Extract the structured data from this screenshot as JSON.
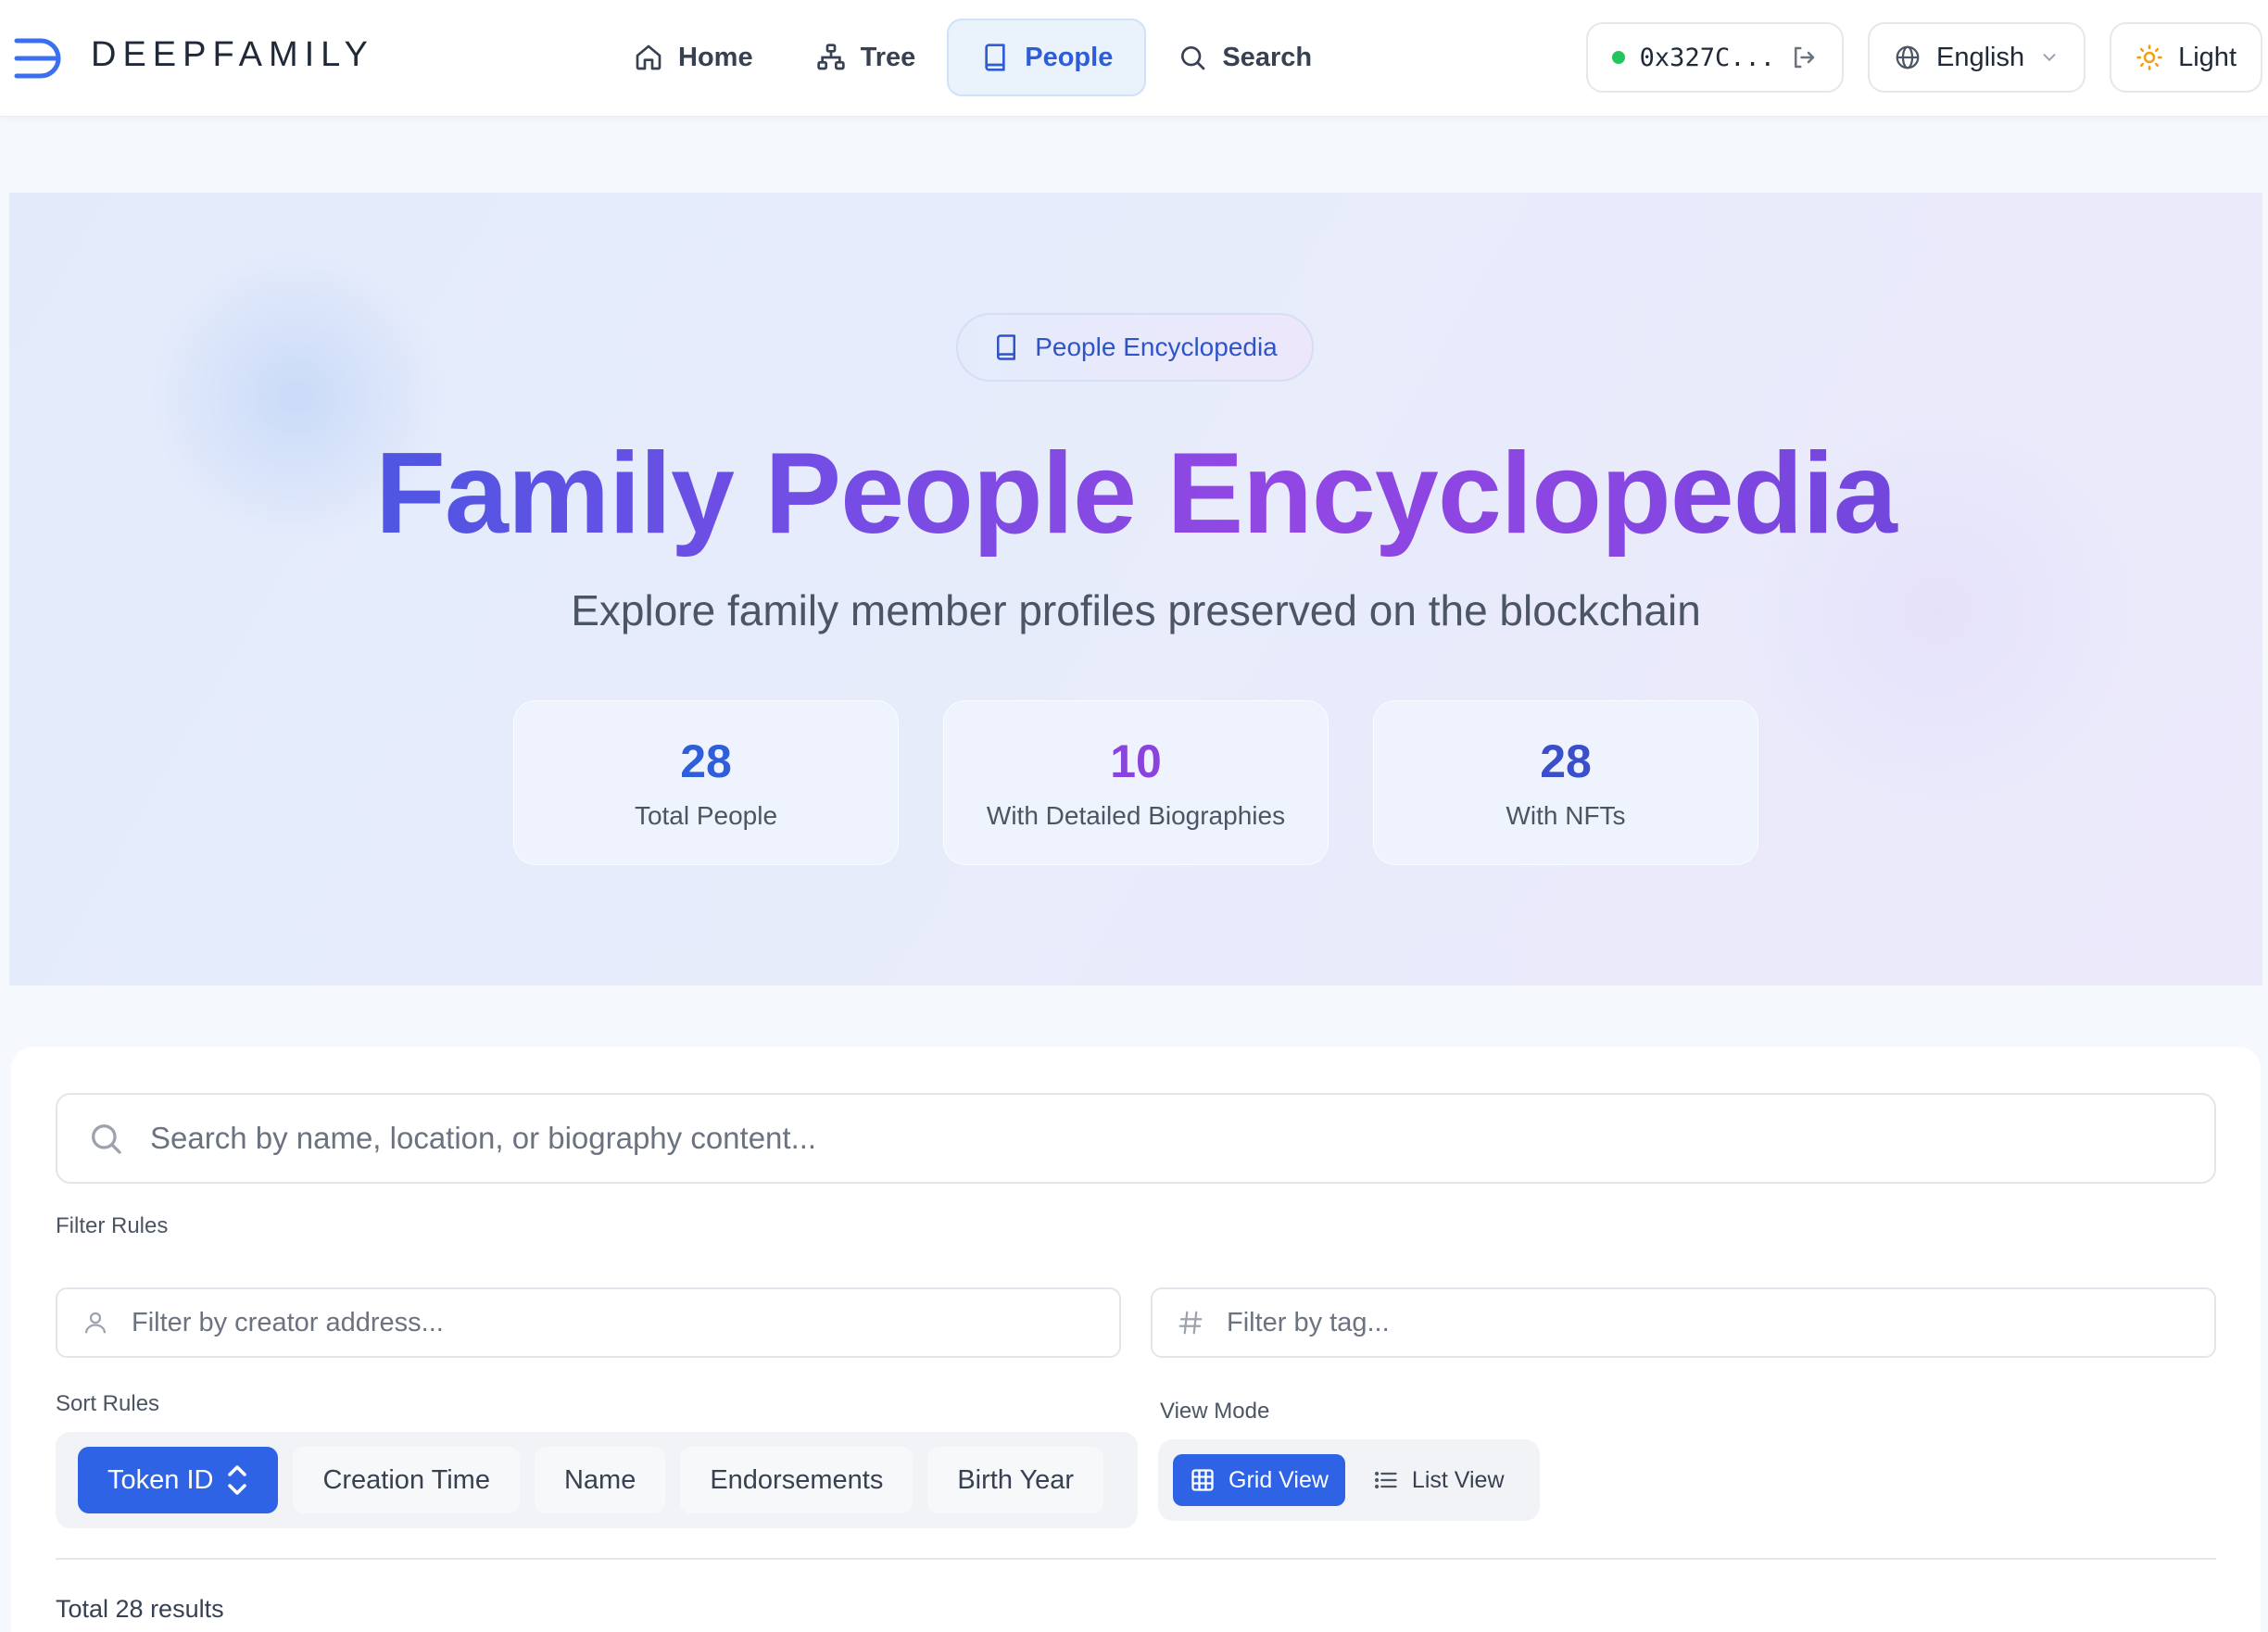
{
  "app": {
    "logo_text": "DEEPFAMILY"
  },
  "nav": {
    "home": "Home",
    "tree": "Tree",
    "people": "People",
    "search": "Search"
  },
  "header_right": {
    "wallet_address": "0x327C...",
    "language": "English",
    "theme": "Light"
  },
  "hero": {
    "badge": "People Encyclopedia",
    "title": "Family People Encyclopedia",
    "subtitle": "Explore family member profiles preserved on the blockchain",
    "stats": [
      {
        "value": "28",
        "label": "Total People",
        "color": "#2e5fd8"
      },
      {
        "value": "10",
        "label": "With Detailed Biographies",
        "color": "#8a44dc"
      },
      {
        "value": "28",
        "label": "With NFTs",
        "color": "#3b4fc9"
      }
    ]
  },
  "search": {
    "placeholder": "Search by name, location, or biography content..."
  },
  "filters": {
    "label": "Filter Rules",
    "creator_placeholder": "Filter by creator address...",
    "tag_placeholder": "Filter by tag..."
  },
  "sort": {
    "label": "Sort Rules",
    "options": [
      "Token ID",
      "Creation Time",
      "Name",
      "Endorsements",
      "Birth Year"
    ],
    "active_index": 0
  },
  "view_mode": {
    "label": "View Mode",
    "grid": "Grid View",
    "list": "List View",
    "active": "grid"
  },
  "results": {
    "total_text": "Total 28 results"
  },
  "colors": {
    "accent": "#2f63e6",
    "active_nav_bg": "#eaf3fc",
    "online_dot": "#22c55e",
    "theme_sun": "#f59e0b"
  }
}
